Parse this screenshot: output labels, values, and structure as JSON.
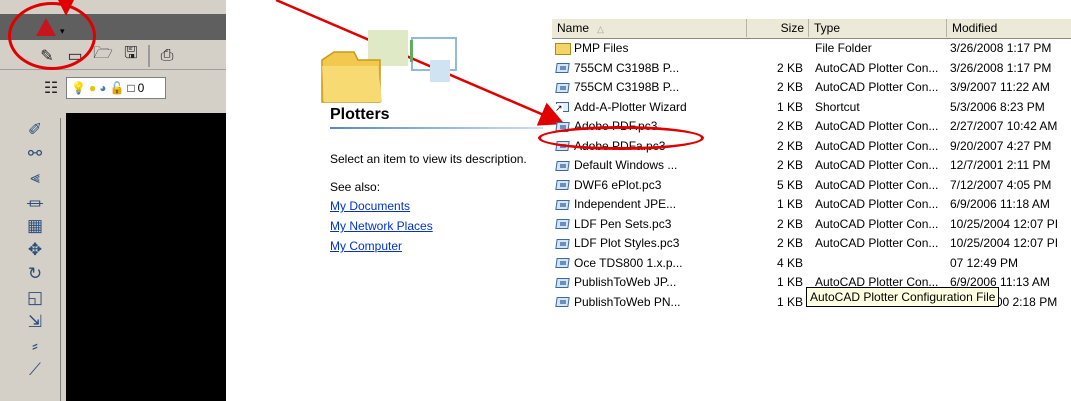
{
  "acad": {
    "app_menu_arrow": "▾",
    "toolbar_field_text": "0",
    "accent_color": "#c8141c",
    "callout_color": "#e00000"
  },
  "explorer": {
    "pane_title": "Plotters",
    "description": "Select an item to view its description.",
    "see_also": "See also:",
    "links": [
      "My Documents",
      "My Network Places",
      "My Computer"
    ]
  },
  "filelist": {
    "columns": {
      "name": "Name",
      "size": "Size",
      "type": "Type",
      "modified": "Modified"
    },
    "sort_indicator": "△",
    "rows": [
      {
        "icon": "folder-icon",
        "name": "PMP Files",
        "size": "",
        "type": "File Folder",
        "modified": "3/26/2008 1:17 PM"
      },
      {
        "icon": "plotter-config-icon",
        "name": "755CM C3198B P...",
        "size": "2 KB",
        "type": "AutoCAD Plotter Con...",
        "modified": "3/26/2008 1:17 PM"
      },
      {
        "icon": "plotter-config-icon",
        "name": "755CM C3198B P...",
        "size": "2 KB",
        "type": "AutoCAD Plotter Con...",
        "modified": "3/9/2007 11:22 AM"
      },
      {
        "icon": "shortcut-icon",
        "name": "Add-A-Plotter Wizard",
        "size": "1 KB",
        "type": "Shortcut",
        "modified": "5/3/2006 8:23 PM"
      },
      {
        "icon": "plotter-config-icon",
        "name": "Adobe PDF.pc3",
        "size": "2 KB",
        "type": "AutoCAD Plotter Con...",
        "modified": "2/27/2007 10:42 AM"
      },
      {
        "icon": "plotter-config-icon",
        "name": "Adobe PDFa.pc3",
        "size": "2 KB",
        "type": "AutoCAD Plotter Con...",
        "modified": "9/20/2007 4:27 PM"
      },
      {
        "icon": "plotter-config-icon",
        "name": "Default Windows ...",
        "size": "2 KB",
        "type": "AutoCAD Plotter Con...",
        "modified": "12/7/2001 2:11 PM"
      },
      {
        "icon": "plotter-config-icon",
        "name": "DWF6 ePlot.pc3",
        "size": "5 KB",
        "type": "AutoCAD Plotter Con...",
        "modified": "7/12/2007 4:05 PM"
      },
      {
        "icon": "plotter-config-icon",
        "name": "Independent JPE...",
        "size": "1 KB",
        "type": "AutoCAD Plotter Con...",
        "modified": "6/9/2006 11:18 AM"
      },
      {
        "icon": "plotter-config-icon",
        "name": "LDF Pen Sets.pc3",
        "size": "2 KB",
        "type": "AutoCAD Plotter Con...",
        "modified": "10/25/2004 12:07 PI"
      },
      {
        "icon": "plotter-config-icon",
        "name": "LDF Plot Styles.pc3",
        "size": "2 KB",
        "type": "AutoCAD Plotter Con...",
        "modified": "10/25/2004 12:07 PI"
      },
      {
        "icon": "plotter-config-icon",
        "name": "Oce TDS800 1.x.p...",
        "size": "4 KB",
        "type": "",
        "modified": "07 12:49 PM"
      },
      {
        "icon": "plotter-config-icon",
        "name": "PublishToWeb JP...",
        "size": "1 KB",
        "type": "AutoCAD Plotter Con...",
        "modified": "6/9/2006 11:13 AM"
      },
      {
        "icon": "plotter-config-icon",
        "name": "PublishToWeb PN...",
        "size": "1 KB",
        "type": "AutoCAD Plotter Con...",
        "modified": "11/21/2000 2:18 PM"
      }
    ],
    "tooltip": "AutoCAD Plotter Configuration File"
  }
}
